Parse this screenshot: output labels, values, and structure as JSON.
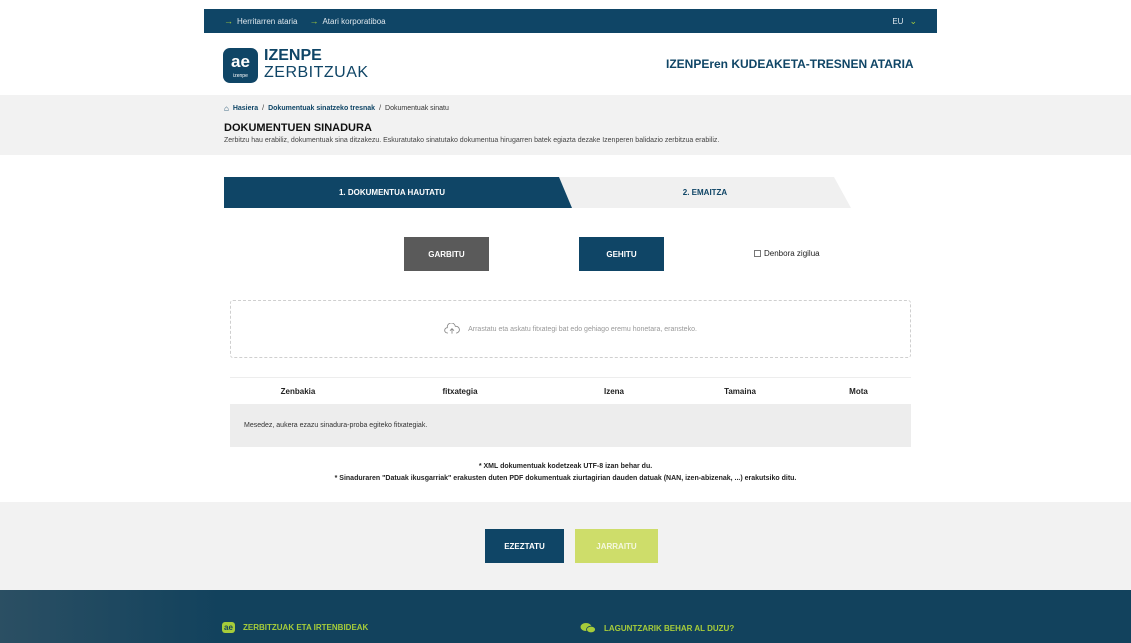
{
  "topbar": {
    "link1": "Herritarren ataria",
    "link2": "Atari korporatiboa",
    "lang": "EU"
  },
  "header": {
    "logo_mark": "ae",
    "logo_small": "izenpe",
    "brand_line1": "IZENPE",
    "brand_line2": "ZERBITZUAK",
    "portal_title": "IZENPEren KUDEAKETA-TRESNEN ATARIA"
  },
  "breadcrumb": {
    "home": "Hasiera",
    "level2": "Dokumentuak sinatzeko tresnak",
    "current": "Dokumentuak sinatu"
  },
  "page": {
    "title": "DOKUMENTUEN SINADURA",
    "description": "Zerbitzu hau erabiliz, dokumentuak sina ditzakezu. Eskuratutako sinatutako dokumentua hirugarren batek egiazta dezake Izenperen balidazio zerbitzua erabiliz."
  },
  "steps": {
    "step1": "1. DOKUMENTUA HAUTATU",
    "step2": "2. EMAITZA"
  },
  "toolbar": {
    "clear_label": "GARBITU",
    "add_label": "GEHITU",
    "timestamp_label": "Denbora zigilua"
  },
  "dropzone": {
    "text": "Arrastatu eta askatu fitxategi bat edo gehiago eremu honetara, eransteko."
  },
  "table": {
    "headers": [
      "Zenbakia",
      "fitxategia",
      "Izena",
      "Tamaina",
      "Mota"
    ],
    "empty_message": "Mesedez, aukera ezazu sinadura-proba egiteko fitxategiak."
  },
  "notes": {
    "line1": "* XML dokumentuak kodetzeak UTF-8 izan behar du.",
    "line2": "* Sinaduraren \"Datuak ikusgarriak\" erakusten duten PDF dokumentuak ziurtagirian dauden datuak (NAN, izen-abizenak, ...) erakutsiko ditu."
  },
  "actions": {
    "cancel_label": "EZEZTATU",
    "continue_label": "JARRAITU"
  },
  "footer": {
    "services_icon_text": "ae",
    "services_label": "ZERBITZUAK ETA IRTENBIDEAK",
    "help_label": "LAGUNTZARIK BEHAR AL DUZU?"
  },
  "colors": {
    "primary": "#0f4566",
    "accent": "#a6cc3a",
    "disabled_button": "#cedd6a",
    "neutral_button": "#5a5a5a"
  }
}
